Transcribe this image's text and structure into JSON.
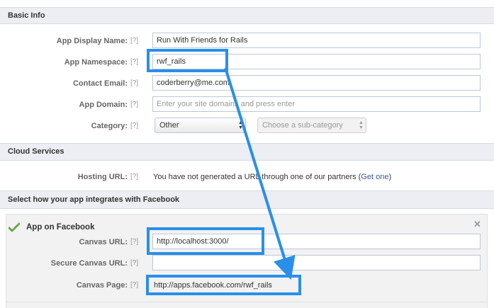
{
  "sections": {
    "basic_info": "Basic Info",
    "cloud_services": "Cloud Services",
    "integration": "Select how your app integrates with Facebook"
  },
  "help_glyph": "[?]",
  "basic": {
    "display_name_label": "App Display Name:",
    "display_name_value": "Run With Friends for Rails",
    "namespace_label": "App Namespace:",
    "namespace_value": "rwf_rails",
    "email_label": "Contact Email:",
    "email_value": "coderberry@me.com",
    "domain_label": "App Domain:",
    "domain_placeholder": "Enter your site domains and press enter",
    "category_label": "Category:",
    "category_value": "Other",
    "subcategory_placeholder": "Choose a sub-category"
  },
  "cloud": {
    "hosting_label": "Hosting URL:",
    "hosting_text": "You have not generated a URL through one of our partners (",
    "get_one_link": "Get one",
    "hosting_text_end": ")"
  },
  "app_on_facebook": {
    "title": "App on Facebook",
    "canvas_url_label": "Canvas URL:",
    "canvas_url_value": "http://localhost:3000/",
    "secure_canvas_url_label": "Secure Canvas URL:",
    "secure_canvas_url_value": "",
    "canvas_page_label": "Canvas Page:",
    "canvas_page_value": "http://apps.facebook.com/rwf_rails"
  },
  "icons": {
    "check": "check-icon",
    "close": "close-icon"
  },
  "colors": {
    "highlight": "#2a8fe8",
    "link": "#3b5998",
    "section_bg": "#eceef4"
  }
}
